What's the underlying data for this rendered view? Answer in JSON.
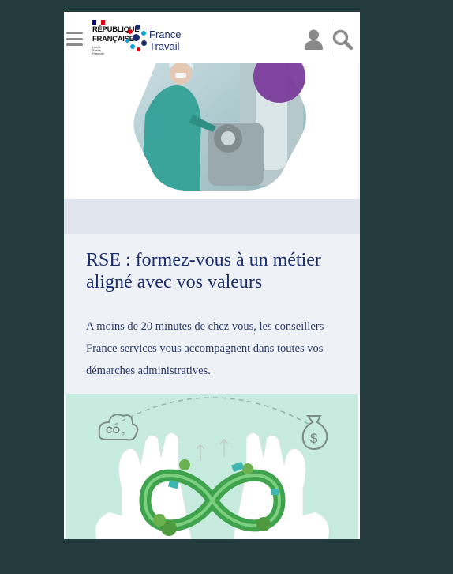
{
  "header": {
    "menu_icon": "hamburger-menu-icon",
    "marianne": {
      "line1": "RÉPUBLIQUE",
      "line2": "FRANÇAISE",
      "devise": [
        "Liberté",
        "Égalité",
        "Fraternité"
      ],
      "flag_colors": [
        "#000091",
        "#ffffff",
        "#e1000f"
      ]
    },
    "brand": {
      "line1": "France",
      "line2": "Travail"
    },
    "user_icon": "user-icon",
    "search_icon": "search-icon"
  },
  "card": {
    "title": "RSE : formez-vous à un métier aligné avec vos valeurs",
    "description": "A moins de 20 minutes de chez vous, les conseillers France services vous accompagnent dans toutes vos démarches administratives."
  },
  "illustrations": {
    "hero": "lab-technician-photo",
    "eco": [
      "co2-cloud-icon",
      "money-bag-icon",
      "infinity-loop",
      "hands"
    ]
  },
  "colors": {
    "brand_blue": "#1c2e6e",
    "accent_purple": "#7a3c9a",
    "eco_green": "#3fa34d",
    "eco_bg": "#c8ebdf",
    "page_bg": "#243c3e"
  }
}
